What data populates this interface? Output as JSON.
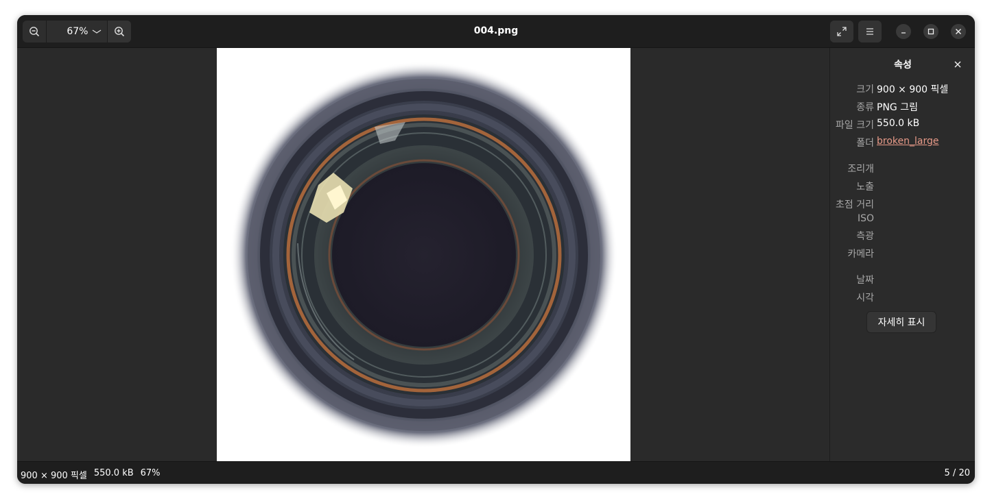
{
  "window": {
    "title": "004.png"
  },
  "header": {
    "zoom_level": "67%",
    "zoom_out_icon": "zoom-out-icon",
    "zoom_in_icon": "zoom-in-icon",
    "fullscreen_icon": "fullscreen-icon",
    "menu_icon": "hamburger-menu-icon"
  },
  "properties": {
    "title": "속성",
    "rows": [
      {
        "key": "크기",
        "value": "900 × 900 픽셀"
      },
      {
        "key": "종류",
        "value": "PNG 그림"
      },
      {
        "key": "파일 크기",
        "value": "550.0 kB"
      },
      {
        "key": "폴더",
        "value": "broken_large"
      },
      {
        "key": "조리개",
        "value": ""
      },
      {
        "key": "노출",
        "value": ""
      },
      {
        "key": "초점 거리",
        "value": ""
      },
      {
        "key": "ISO",
        "value": ""
      },
      {
        "key": "측광",
        "value": ""
      },
      {
        "key": "카메라",
        "value": ""
      },
      {
        "key": "날짜",
        "value": ""
      },
      {
        "key": "시각",
        "value": ""
      }
    ],
    "details_button": "자세히 표시"
  },
  "status": {
    "dimensions": "900 × 900 픽셀",
    "size": "550.0 kB",
    "zoom": "67%",
    "position": "5 / 20"
  },
  "colors": {
    "link": "#e89a88",
    "headerbar": "#1e1e1e",
    "background": "#2a2a2a"
  }
}
